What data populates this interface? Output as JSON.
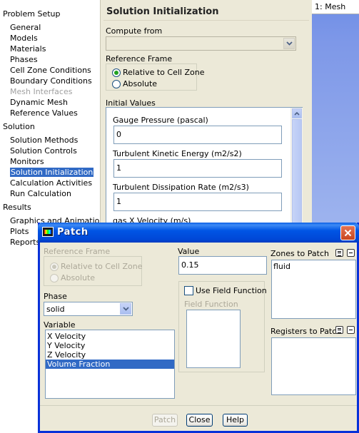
{
  "tree": {
    "sections": [
      {
        "label": "Problem Setup",
        "items": [
          {
            "label": "General"
          },
          {
            "label": "Models"
          },
          {
            "label": "Materials"
          },
          {
            "label": "Phases"
          },
          {
            "label": "Cell Zone Conditions"
          },
          {
            "label": "Boundary Conditions"
          },
          {
            "label": "Mesh Interfaces",
            "disabled": true
          },
          {
            "label": "Dynamic Mesh"
          },
          {
            "label": "Reference Values"
          }
        ]
      },
      {
        "label": "Solution",
        "items": [
          {
            "label": "Solution Methods"
          },
          {
            "label": "Solution Controls"
          },
          {
            "label": "Monitors"
          },
          {
            "label": "Solution Initialization",
            "selected": true
          },
          {
            "label": "Calculation Activities"
          },
          {
            "label": "Run Calculation"
          }
        ]
      },
      {
        "label": "Results",
        "items": [
          {
            "label": "Graphics and Animations"
          },
          {
            "label": "Plots"
          },
          {
            "label": "Reports"
          }
        ]
      }
    ]
  },
  "task": {
    "title": "Solution Initialization",
    "compute_from_label": "Compute from",
    "compute_from_value": "",
    "reference_frame_label": "Reference Frame",
    "ref_options": [
      "Relative to Cell Zone",
      "Absolute"
    ],
    "ref_selected": 0,
    "initial_values_label": "Initial Values",
    "fields": [
      {
        "label": "Gauge Pressure (pascal)",
        "value": "0"
      },
      {
        "label": "Turbulent Kinetic Energy (m2/s2)",
        "value": "1"
      },
      {
        "label": "Turbulent Dissipation Rate (m2/s3)",
        "value": "1"
      },
      {
        "label": "gas X Velocity (m/s)",
        "value": ""
      }
    ]
  },
  "graphics": {
    "tab": "1: Mesh"
  },
  "dialog": {
    "title": "Patch",
    "reference_frame_label": "Reference Frame",
    "ref_options": [
      "Relative to Cell Zone",
      "Absolute"
    ],
    "phase_label": "Phase",
    "phase_value": "solid",
    "variable_label": "Variable",
    "variables": [
      "X Velocity",
      "Y Velocity",
      "Z Velocity",
      "Volume Fraction"
    ],
    "variable_selected": 3,
    "value_label": "Value",
    "value": "0.15",
    "use_field_function_label": "Use Field Function",
    "field_function_label": "Field Function",
    "zones_label": "Zones to Patch",
    "zones": [
      "fluid"
    ],
    "registers_label": "Registers to Patch",
    "registers": [],
    "buttons": {
      "patch": "Patch",
      "close": "Close",
      "help": "Help"
    }
  },
  "colors": {
    "selection": "#316ac5",
    "titlebar": "#0055e5",
    "dialog_bg": "#ece9d8"
  }
}
